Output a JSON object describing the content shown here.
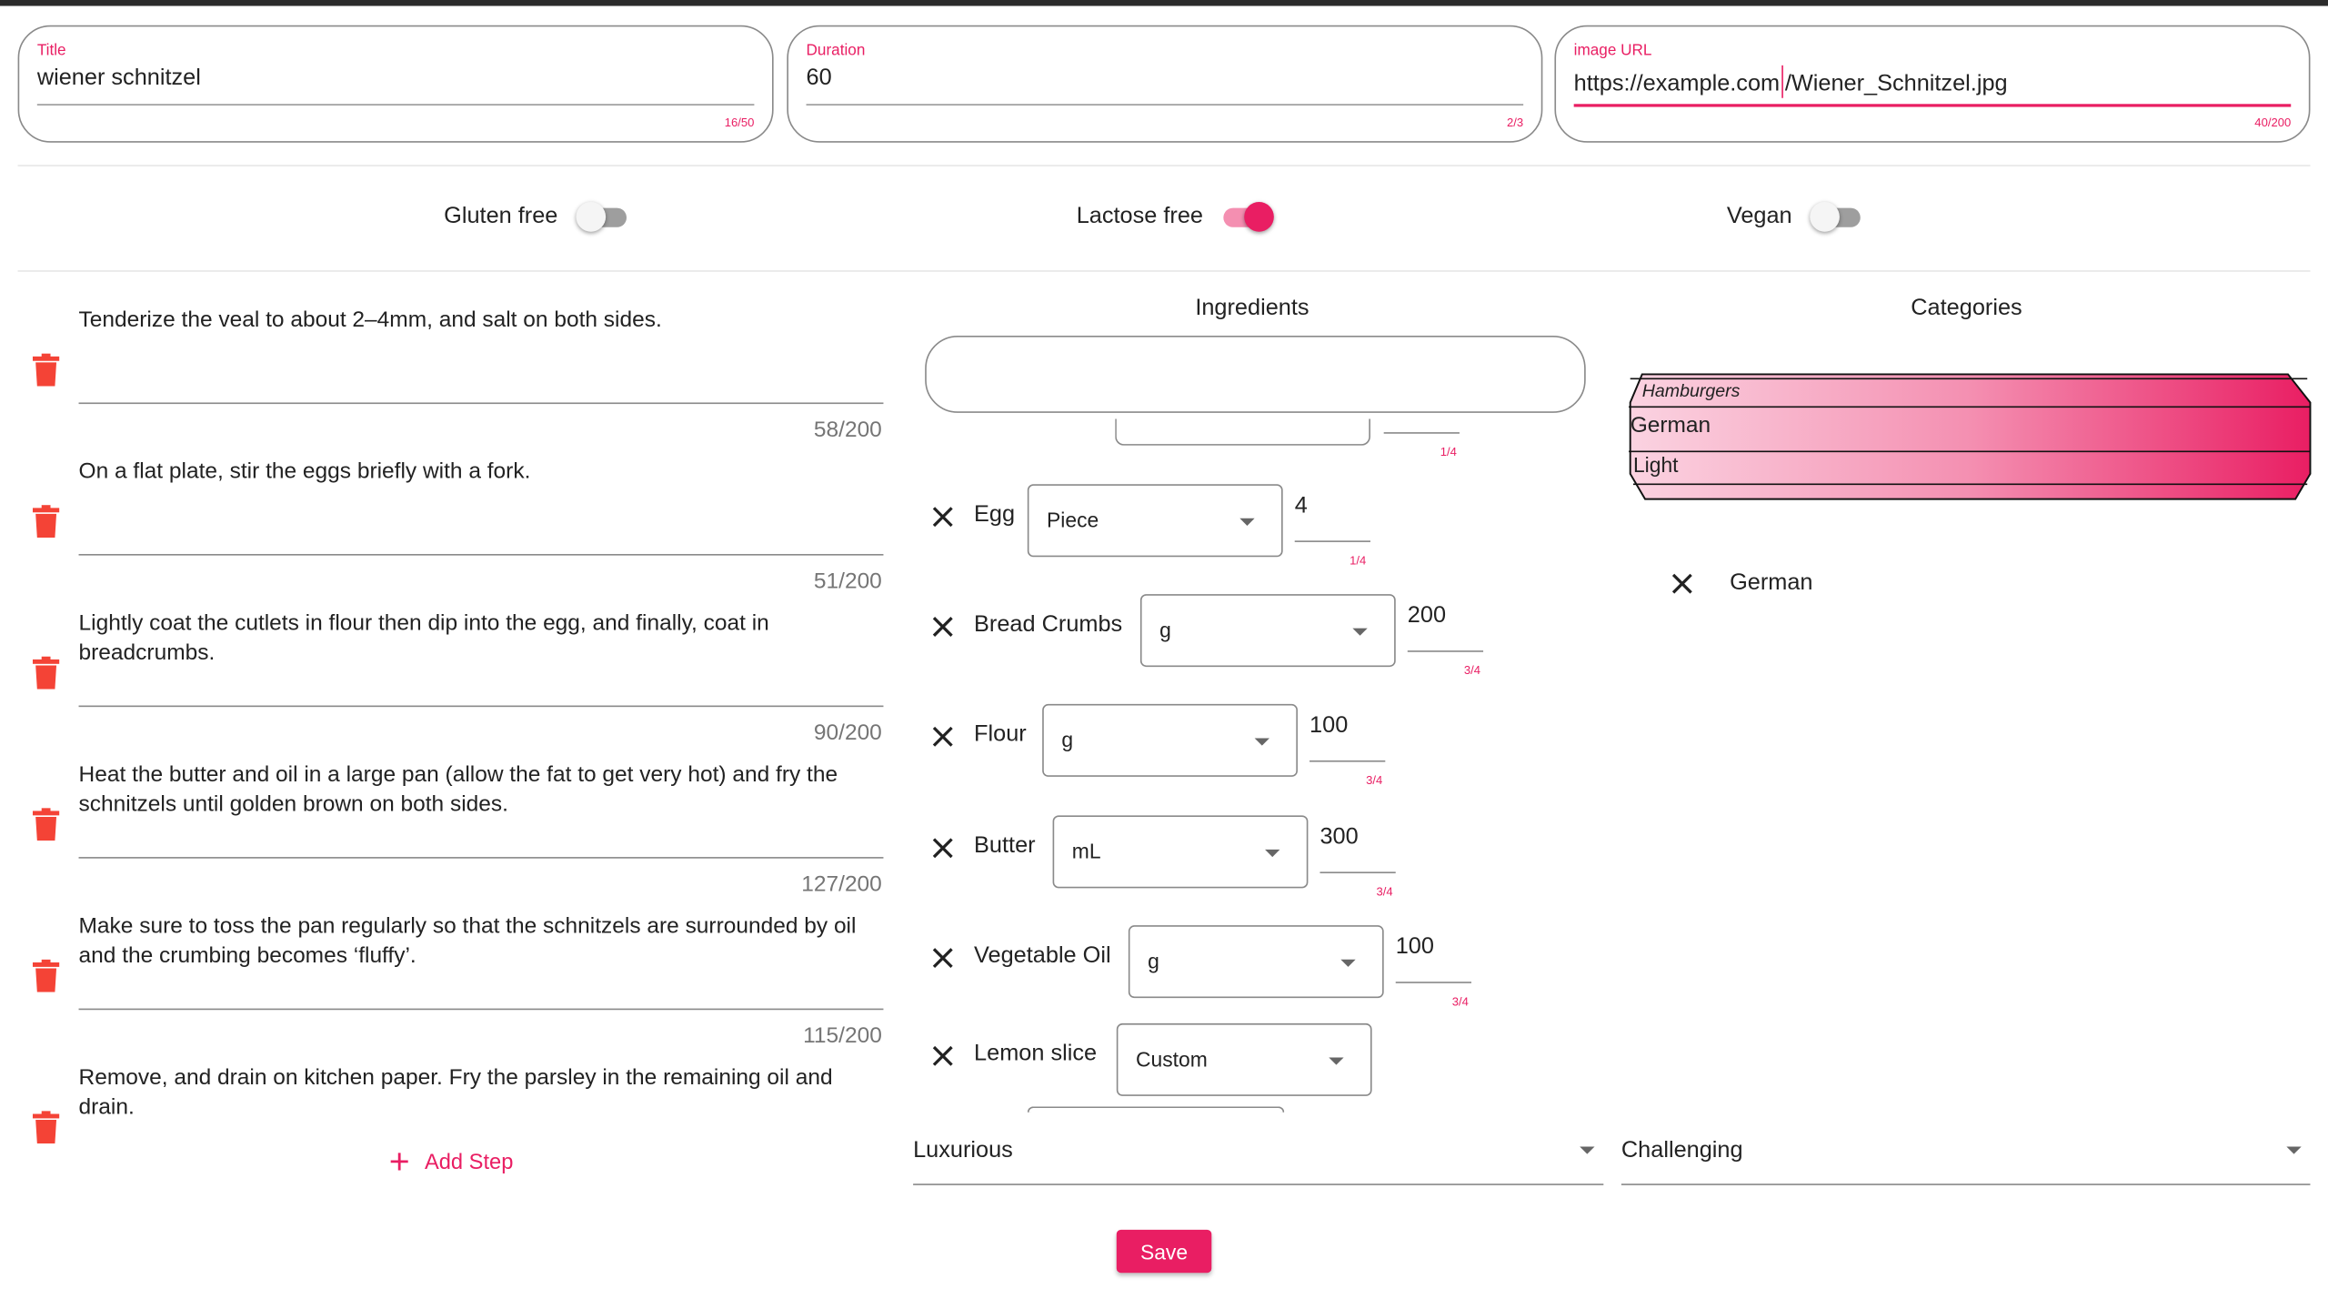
{
  "fields": {
    "title": {
      "label": "Title",
      "value": "wiener schnitzel",
      "counter": "16/50"
    },
    "duration": {
      "label": "Duration",
      "value": "60",
      "counter": "2/3"
    },
    "image_url": {
      "label": "image URL",
      "value_before_caret": "https://example.com",
      "value_after_caret": "/Wiener_Schnitzel.jpg",
      "counter": "40/200"
    }
  },
  "toggles": [
    {
      "label": "Gluten free",
      "on": false
    },
    {
      "label": "Lactose free",
      "on": true
    },
    {
      "label": "Vegan",
      "on": false
    }
  ],
  "steps": [
    {
      "text": "Tenderize the veal to about 2–4mm, and salt on both sides.",
      "counter": "58/200"
    },
    {
      "text": "On a flat plate, stir the eggs briefly with a fork.",
      "counter": "51/200"
    },
    {
      "text": "Lightly coat the cutlets in flour then dip into the egg, and finally, coat in breadcrumbs.",
      "counter": "90/200"
    },
    {
      "text": "Heat the butter and oil in a large pan (allow the fat to get very hot) and fry the schnitzels until golden brown on both sides.",
      "counter": "127/200"
    },
    {
      "text": "Make sure to toss the pan regularly so that the schnitzels are surrounded by oil and the crumbing becomes ‘fluffy’.",
      "counter": "115/200"
    },
    {
      "text": "Remove, and drain on kitchen paper. Fry the parsley in the remaining oil and drain.",
      "counter": ""
    }
  ],
  "add_step_label": "Add Step",
  "ingredients": {
    "title": "Ingredients",
    "ghost_counter": "1/4",
    "items": [
      {
        "name": "Egg",
        "unit": "Piece",
        "quantity": "4",
        "counter": "1/4"
      },
      {
        "name": "Bread Crumbs",
        "unit": "g",
        "quantity": "200",
        "counter": "3/4"
      },
      {
        "name": "Flour",
        "unit": "g",
        "quantity": "100",
        "counter": "3/4"
      },
      {
        "name": "Butter",
        "unit": "mL",
        "quantity": "300",
        "counter": "3/4"
      },
      {
        "name": "Vegetable Oil",
        "unit": "g",
        "quantity": "100",
        "counter": "3/4"
      },
      {
        "name": "Lemon slice",
        "unit": "Custom",
        "quantity": "",
        "counter": ""
      }
    ]
  },
  "categories": {
    "title": "Categories",
    "wheel_options": [
      "Hamburgers",
      "German",
      "Light"
    ],
    "selected_chip": "German",
    "wheel_color": "#e91e63"
  },
  "price_select": {
    "value": "Luxurious"
  },
  "difficulty_select": {
    "value": "Challenging"
  },
  "save_label": "Save",
  "colors": {
    "accent": "#e91e63",
    "delete": "#f44336"
  },
  "icons": {
    "delete": "trash-icon",
    "remove": "close-icon",
    "add": "plus-icon",
    "dropdown": "arrow-drop-down-icon"
  }
}
